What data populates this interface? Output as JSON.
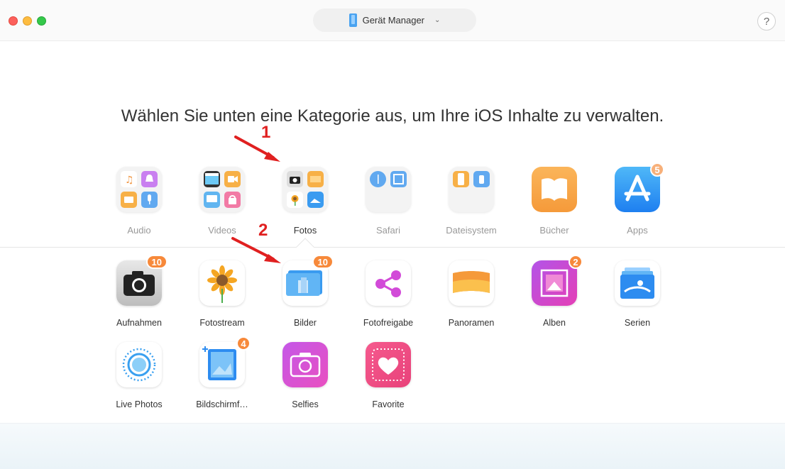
{
  "window": {
    "device_selector_label": "Gerät Manager",
    "help_label": "?"
  },
  "headline": "Wählen Sie unten eine Kategorie aus, um Ihre iOS Inhalte zu verwalten.",
  "categories": [
    {
      "label": "Audio"
    },
    {
      "label": "Videos"
    },
    {
      "label": "Fotos",
      "active": true
    },
    {
      "label": "Safari"
    },
    {
      "label": "Dateisystem"
    },
    {
      "label": "Bücher"
    },
    {
      "label": "Apps",
      "badge": "5"
    }
  ],
  "subcategories": [
    {
      "label": "Aufnahmen",
      "badge": "10"
    },
    {
      "label": "Fotostream"
    },
    {
      "label": "Bilder",
      "badge": "10"
    },
    {
      "label": "Fotofreigabe"
    },
    {
      "label": "Panoramen"
    },
    {
      "label": "Alben",
      "badge": "2"
    },
    {
      "label": "Serien"
    },
    {
      "label": "Live Photos"
    },
    {
      "label": "Bildschirmf…",
      "badge": "4"
    },
    {
      "label": "Selfies"
    },
    {
      "label": "Favorite"
    }
  ],
  "annotations": [
    {
      "label": "1"
    },
    {
      "label": "2"
    }
  ],
  "colors": {
    "accent_badge": "#f7893a",
    "annotation_red": "#e02020"
  }
}
